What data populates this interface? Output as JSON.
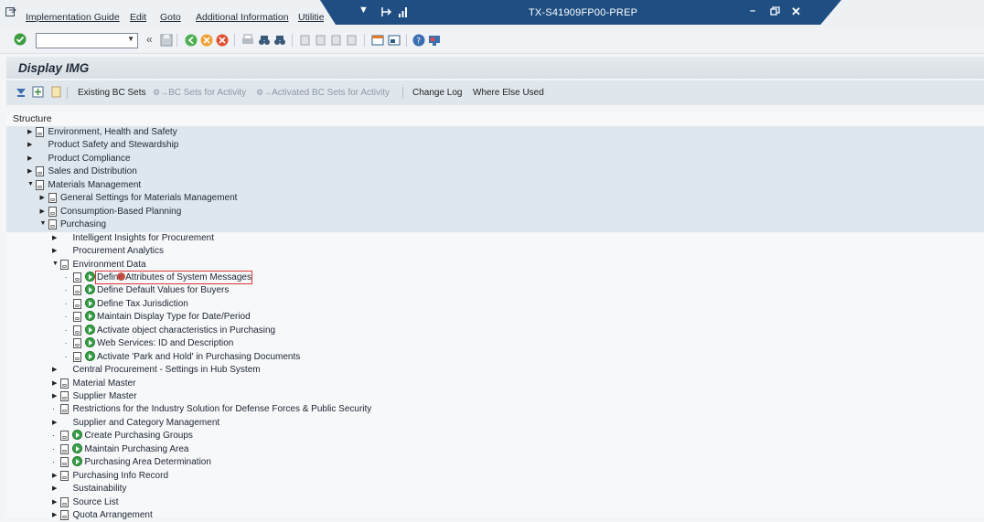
{
  "menubar": {
    "items": [
      "Implementation Guide",
      "Edit",
      "Goto",
      "Additional Information",
      "Utilities"
    ],
    "system_title": "TX-S41909FP00-PREP"
  },
  "toolbar": {
    "command_field_value": "",
    "enter_icon": "check-icon"
  },
  "page": {
    "title": "Display IMG"
  },
  "apptoolbar": {
    "existing_bc_sets": "Existing BC Sets",
    "bc_sets_for_activity": "BC Sets for Activity",
    "activated_bc_sets": "Activated BC Sets for Activity",
    "change_log": "Change Log",
    "where_else_used": "Where Else Used"
  },
  "tree": {
    "header": "Structure",
    "rows": [
      {
        "label": "Environment, Health and Safety",
        "level": 0,
        "arrow": "right",
        "doc": true,
        "exec": false
      },
      {
        "label": "Product Safety and Stewardship",
        "level": 0,
        "arrow": "right",
        "doc": false,
        "exec": false
      },
      {
        "label": "Product Compliance",
        "level": 0,
        "arrow": "right",
        "doc": false,
        "exec": false
      },
      {
        "label": "Sales and Distribution",
        "level": 0,
        "arrow": "right",
        "doc": true,
        "exec": false
      },
      {
        "label": "Materials Management",
        "level": 0,
        "arrow": "down",
        "doc": true,
        "exec": false
      },
      {
        "label": "General Settings for Materials Management",
        "level": 1,
        "arrow": "right",
        "doc": true,
        "exec": false
      },
      {
        "label": "Consumption-Based Planning",
        "level": 1,
        "arrow": "right",
        "doc": true,
        "exec": false
      },
      {
        "label": "Purchasing",
        "level": 1,
        "arrow": "down",
        "doc": true,
        "exec": false
      },
      {
        "label": "Intelligent Insights for Procurement",
        "level": 2,
        "arrow": "right",
        "doc": false,
        "exec": false
      },
      {
        "label": "Procurement Analytics",
        "level": 2,
        "arrow": "right",
        "doc": false,
        "exec": false
      },
      {
        "label": "Environment Data",
        "level": 2,
        "arrow": "down",
        "doc": true,
        "exec": false
      },
      {
        "label": "Define Attributes of System Messages",
        "level": 3,
        "arrow": "dot",
        "doc": true,
        "exec": true,
        "selected": true
      },
      {
        "label": "Define Default Values for Buyers",
        "level": 3,
        "arrow": "dot",
        "doc": true,
        "exec": true
      },
      {
        "label": "Define Tax Jurisdiction",
        "level": 3,
        "arrow": "dot",
        "doc": true,
        "exec": true
      },
      {
        "label": "Maintain Display Type for Date/Period",
        "level": 3,
        "arrow": "dot",
        "doc": true,
        "exec": true
      },
      {
        "label": "Activate object characteristics in Purchasing",
        "level": 3,
        "arrow": "dot",
        "doc": true,
        "exec": true
      },
      {
        "label": "Web Services: ID and Description",
        "level": 3,
        "arrow": "dot",
        "doc": true,
        "exec": true
      },
      {
        "label": "Activate 'Park and Hold' in Purchasing Documents",
        "level": 3,
        "arrow": "dot",
        "doc": true,
        "exec": true
      },
      {
        "label": "Central Procurement - Settings in Hub System",
        "level": 2,
        "arrow": "right",
        "doc": false,
        "exec": false
      },
      {
        "label": "Material Master",
        "level": 2,
        "arrow": "right",
        "doc": true,
        "exec": false
      },
      {
        "label": "Supplier Master",
        "level": 2,
        "arrow": "right",
        "doc": true,
        "exec": false
      },
      {
        "label": "Restrictions for the Industry Solution for Defense Forces & Public Security",
        "level": 2,
        "arrow": "dot",
        "doc": true,
        "exec": false
      },
      {
        "label": "Supplier and Category Management",
        "level": 2,
        "arrow": "right",
        "doc": false,
        "exec": false
      },
      {
        "label": "Create Purchasing Groups",
        "level": 2,
        "arrow": "dot",
        "doc": true,
        "exec": true
      },
      {
        "label": "Maintain Purchasing Area",
        "level": 2,
        "arrow": "dot",
        "doc": true,
        "exec": true
      },
      {
        "label": "Purchasing Area Determination",
        "level": 2,
        "arrow": "dot",
        "doc": true,
        "exec": true
      },
      {
        "label": "Purchasing Info Record",
        "level": 2,
        "arrow": "right",
        "doc": true,
        "exec": false
      },
      {
        "label": "Sustainability",
        "level": 2,
        "arrow": "right",
        "doc": false,
        "exec": false
      },
      {
        "label": "Source List",
        "level": 2,
        "arrow": "right",
        "doc": true,
        "exec": false
      },
      {
        "label": "Quota Arrangement",
        "level": 2,
        "arrow": "right",
        "doc": true,
        "exec": false
      }
    ]
  }
}
